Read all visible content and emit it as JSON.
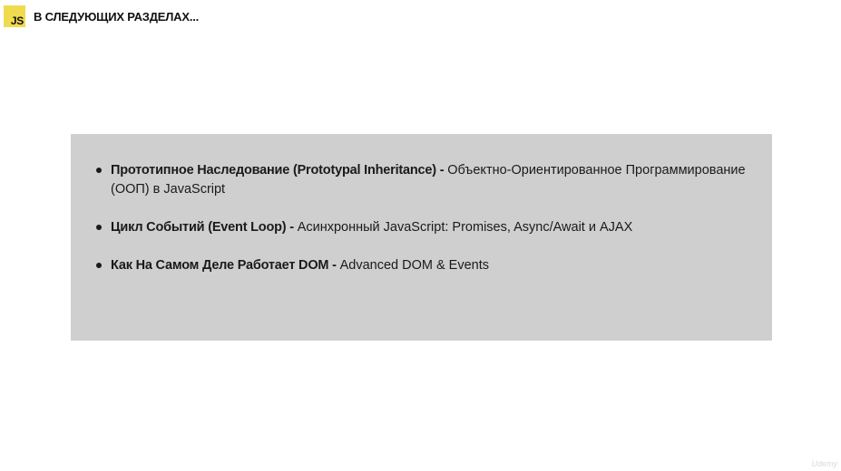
{
  "header": {
    "logo_text": "JS",
    "title": "В СЛЕДУЮЩИХ РАЗДЕЛАХ..."
  },
  "topics": [
    {
      "title": "Прототипное Наследование (Prototypal Inheritance) -",
      "description": "Объектно-Ориентированное Программирование (ООП) в JavaScript"
    },
    {
      "title": "Цикл Событий (Event Loop) -",
      "description": "Асинхронный JavaScript: Promises, Async/Await и AJAX"
    },
    {
      "title": "Как На Самом Деле Работает DOM -",
      "description": "Advanced DOM & Events"
    }
  ],
  "watermark": "Udemy",
  "colors": {
    "js_yellow": "#f0db4f",
    "panel_gray": "#cfcfcf",
    "text": "#111111"
  }
}
